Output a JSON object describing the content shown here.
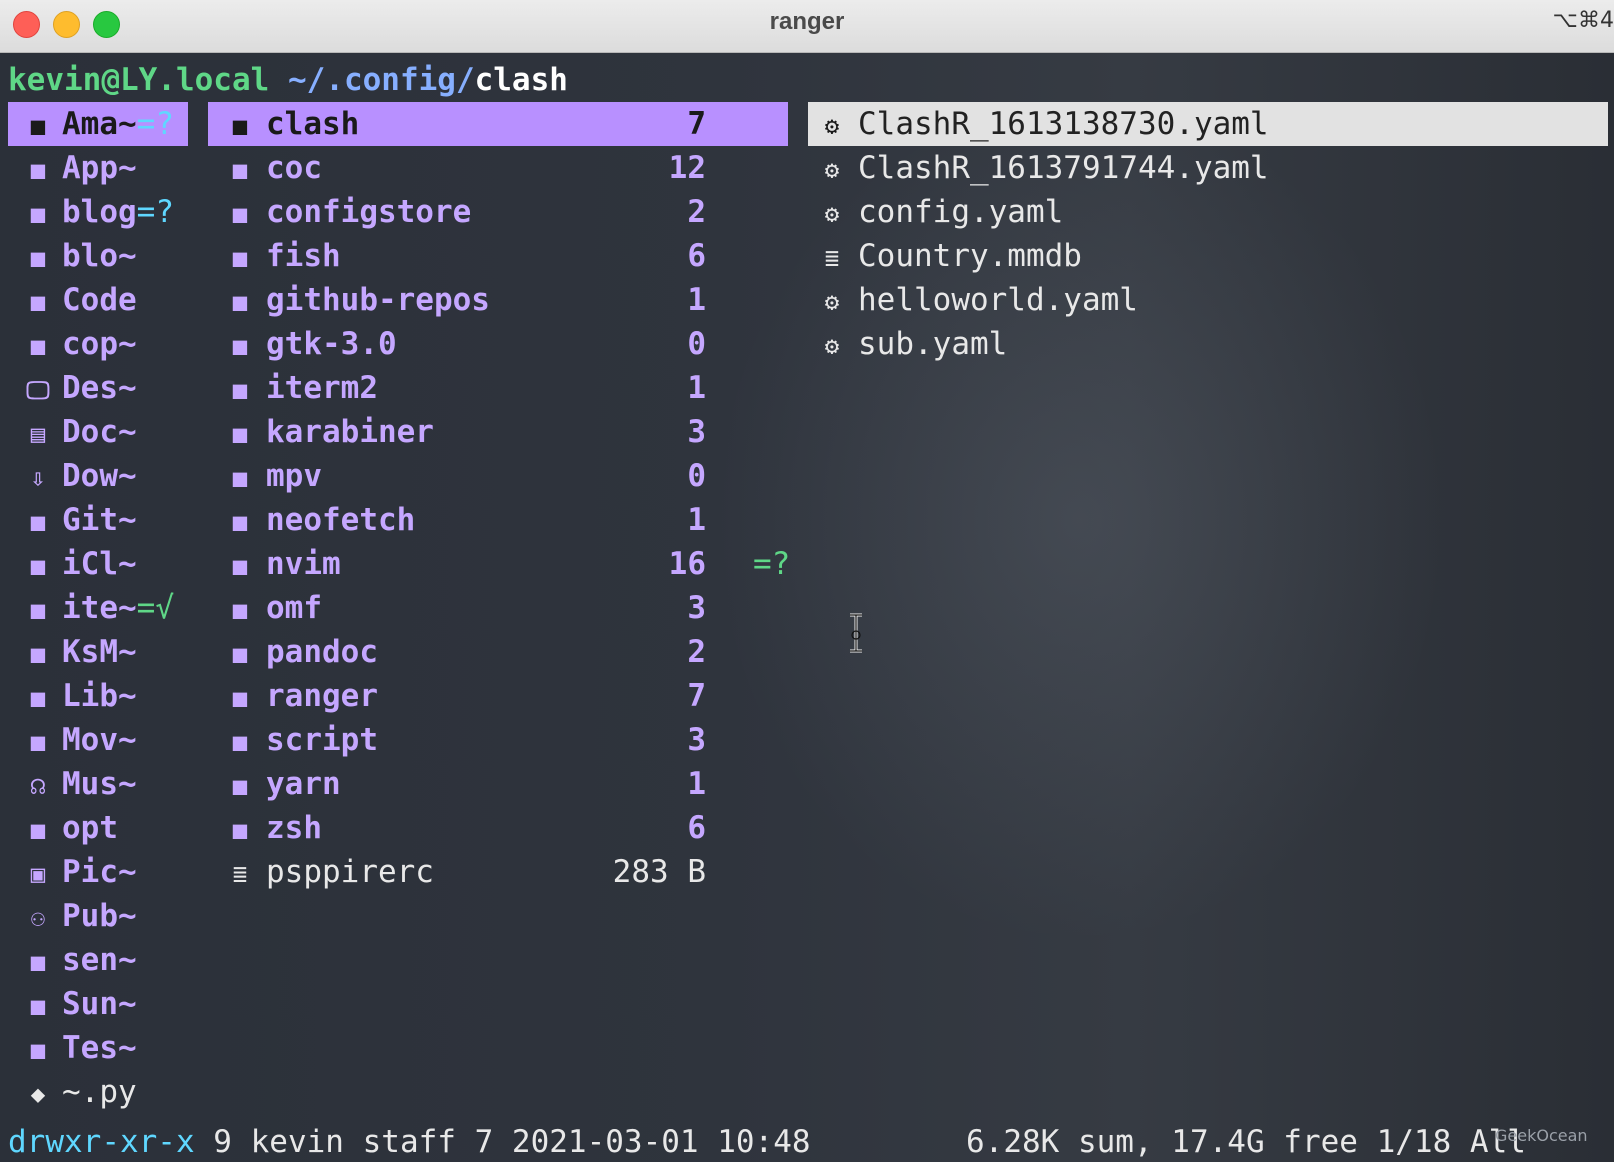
{
  "window": {
    "title": "ranger",
    "shortcut": "⌥⌘4"
  },
  "prompt": {
    "user_host": "kevin@LY.local",
    "path": "~/.config/",
    "current": "clash"
  },
  "parent_column": [
    {
      "icon": "folder-icon",
      "glyph": "■",
      "name": "Ama~",
      "tag": "=?",
      "tag_type": "q",
      "selected": true
    },
    {
      "icon": "folder-icon",
      "glyph": "■",
      "name": "App~",
      "tag": "",
      "tag_type": "",
      "selected": false
    },
    {
      "icon": "folder-icon",
      "glyph": "■",
      "name": "blog",
      "tag": "=?",
      "tag_type": "q",
      "selected": false
    },
    {
      "icon": "folder-icon",
      "glyph": "■",
      "name": "blo~",
      "tag": "",
      "tag_type": "",
      "selected": false
    },
    {
      "icon": "folder-icon",
      "glyph": "■",
      "name": "Code",
      "tag": "",
      "tag_type": "",
      "selected": false
    },
    {
      "icon": "folder-icon",
      "glyph": "■",
      "name": "cop~",
      "tag": "",
      "tag_type": "",
      "selected": false
    },
    {
      "icon": "desktop-icon",
      "glyph": "🖵",
      "name": "Des~",
      "tag": "",
      "tag_type": "",
      "selected": false
    },
    {
      "icon": "document-icon",
      "glyph": "▤",
      "name": "Doc~",
      "tag": "",
      "tag_type": "",
      "selected": false
    },
    {
      "icon": "download-icon",
      "glyph": "⇩",
      "name": "Dow~",
      "tag": "",
      "tag_type": "",
      "selected": false
    },
    {
      "icon": "folder-icon",
      "glyph": "■",
      "name": "Git~",
      "tag": "",
      "tag_type": "",
      "selected": false
    },
    {
      "icon": "folder-icon",
      "glyph": "■",
      "name": "iCl~",
      "tag": "",
      "tag_type": "",
      "selected": false
    },
    {
      "icon": "folder-icon",
      "glyph": "■",
      "name": "ite~",
      "tag": "=√",
      "tag_type": "ok",
      "selected": false
    },
    {
      "icon": "folder-icon",
      "glyph": "■",
      "name": "KsM~",
      "tag": "",
      "tag_type": "",
      "selected": false
    },
    {
      "icon": "folder-icon",
      "glyph": "■",
      "name": "Lib~",
      "tag": "",
      "tag_type": "",
      "selected": false
    },
    {
      "icon": "folder-icon",
      "glyph": "■",
      "name": "Mov~",
      "tag": "",
      "tag_type": "",
      "selected": false
    },
    {
      "icon": "headphones-icon",
      "glyph": "☊",
      "name": "Mus~",
      "tag": "",
      "tag_type": "",
      "selected": false
    },
    {
      "icon": "folder-icon",
      "glyph": "■",
      "name": "opt",
      "tag": "",
      "tag_type": "",
      "selected": false
    },
    {
      "icon": "picture-icon",
      "glyph": "▣",
      "name": "Pic~",
      "tag": "",
      "tag_type": "",
      "selected": false
    },
    {
      "icon": "users-icon",
      "glyph": "⚇",
      "name": "Pub~",
      "tag": "",
      "tag_type": "",
      "selected": false
    },
    {
      "icon": "folder-icon",
      "glyph": "■",
      "name": "sen~",
      "tag": "",
      "tag_type": "",
      "selected": false
    },
    {
      "icon": "folder-icon",
      "glyph": "■",
      "name": "Sun~",
      "tag": "",
      "tag_type": "",
      "selected": false
    },
    {
      "icon": "folder-icon",
      "glyph": "■",
      "name": "Tes~",
      "tag": "",
      "tag_type": "",
      "selected": false
    },
    {
      "icon": "python-icon",
      "glyph": "◆",
      "name": "~.py",
      "tag": "",
      "tag_type": "",
      "selected": false,
      "file": true
    }
  ],
  "current_column": [
    {
      "icon": "folder-icon",
      "glyph": "■",
      "name": "clash",
      "count": "7",
      "tag": "",
      "selected": true
    },
    {
      "icon": "folder-icon",
      "glyph": "■",
      "name": "coc",
      "count": "12",
      "tag": "",
      "selected": false
    },
    {
      "icon": "folder-icon",
      "glyph": "■",
      "name": "configstore",
      "count": "2",
      "tag": "",
      "selected": false
    },
    {
      "icon": "folder-icon",
      "glyph": "■",
      "name": "fish",
      "count": "6",
      "tag": "",
      "selected": false
    },
    {
      "icon": "folder-icon",
      "glyph": "■",
      "name": "github-repos",
      "count": "1",
      "tag": "",
      "selected": false
    },
    {
      "icon": "folder-icon",
      "glyph": "■",
      "name": "gtk-3.0",
      "count": "0",
      "tag": "",
      "selected": false
    },
    {
      "icon": "folder-icon",
      "glyph": "■",
      "name": "iterm2",
      "count": "1",
      "tag": "",
      "selected": false
    },
    {
      "icon": "folder-icon",
      "glyph": "■",
      "name": "karabiner",
      "count": "3",
      "tag": "",
      "selected": false
    },
    {
      "icon": "folder-icon",
      "glyph": "■",
      "name": "mpv",
      "count": "0",
      "tag": "",
      "selected": false
    },
    {
      "icon": "folder-icon",
      "glyph": "■",
      "name": "neofetch",
      "count": "1",
      "tag": "",
      "selected": false
    },
    {
      "icon": "folder-icon",
      "glyph": "■",
      "name": "nvim",
      "count": "16",
      "tag": "=?",
      "selected": false
    },
    {
      "icon": "folder-icon",
      "glyph": "■",
      "name": "omf",
      "count": "3",
      "tag": "",
      "selected": false
    },
    {
      "icon": "folder-icon",
      "glyph": "■",
      "name": "pandoc",
      "count": "2",
      "tag": "",
      "selected": false
    },
    {
      "icon": "folder-icon",
      "glyph": "■",
      "name": "ranger",
      "count": "7",
      "tag": "",
      "selected": false
    },
    {
      "icon": "folder-icon",
      "glyph": "■",
      "name": "script",
      "count": "3",
      "tag": "",
      "selected": false
    },
    {
      "icon": "folder-icon",
      "glyph": "■",
      "name": "yarn",
      "count": "1",
      "tag": "",
      "selected": false
    },
    {
      "icon": "folder-icon",
      "glyph": "■",
      "name": "zsh",
      "count": "6",
      "tag": "",
      "selected": false
    },
    {
      "icon": "text-file-icon",
      "glyph": "≣",
      "name": "psppirerc",
      "count": "283 B",
      "tag": "",
      "selected": false,
      "file": true
    }
  ],
  "preview_column": [
    {
      "icon": "gear-icon",
      "glyph": "⚙",
      "name": "ClashR_1613138730.yaml",
      "selected": true
    },
    {
      "icon": "gear-icon",
      "glyph": "⚙",
      "name": "ClashR_1613791744.yaml",
      "selected": false
    },
    {
      "icon": "gear-icon",
      "glyph": "⚙",
      "name": "config.yaml",
      "selected": false
    },
    {
      "icon": "text-file-icon",
      "glyph": "≣",
      "name": "Country.mmdb",
      "selected": false
    },
    {
      "icon": "gear-icon",
      "glyph": "⚙",
      "name": "helloworld.yaml",
      "selected": false
    },
    {
      "icon": "gear-icon",
      "glyph": "⚙",
      "name": "sub.yaml",
      "selected": false
    }
  ],
  "status": {
    "permissions": "drwxr-xr-x",
    "info": " 9 kevin staff 7 2021-03-01 10:48",
    "summary": "6.28K sum, 17.4G free  1/18  All"
  },
  "watermark": "GeekOcean"
}
